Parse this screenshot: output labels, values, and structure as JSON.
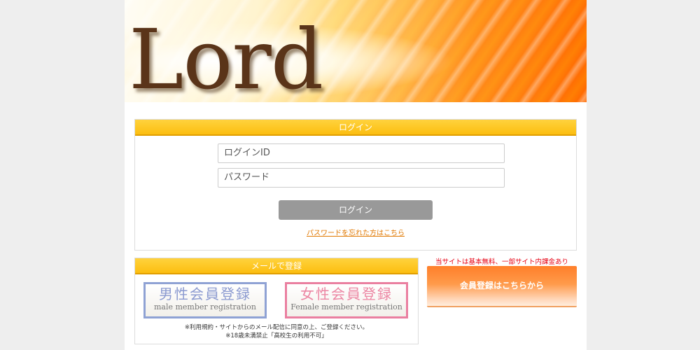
{
  "banner": {
    "logo_text": "Lord"
  },
  "login": {
    "header": "ログイン",
    "id_placeholder": "ログインID",
    "password_placeholder": "パスワード",
    "button_label": "ログイン",
    "forgot_link": "パスワードを忘れた方はこちら"
  },
  "mail_register": {
    "header": "メールで登録",
    "male": {
      "title": "男性会員登録",
      "subtitle": "male member registration"
    },
    "female": {
      "title": "女性会員登録",
      "subtitle": "Female member registration"
    },
    "note1": "※利用規約・サイトからのメール配信に同意の上、ご登録ください。",
    "note2": "※18歳未満禁止「高校生の利用不可」"
  },
  "member": {
    "free_note": "当サイトは基本無料、一部サイト内課金あり",
    "button_label": "会員登録はこちらから"
  },
  "colors": {
    "accent": "#fcbe10",
    "link": "#e07800",
    "warning": "#e60012",
    "cta": "#ff7f2a"
  }
}
